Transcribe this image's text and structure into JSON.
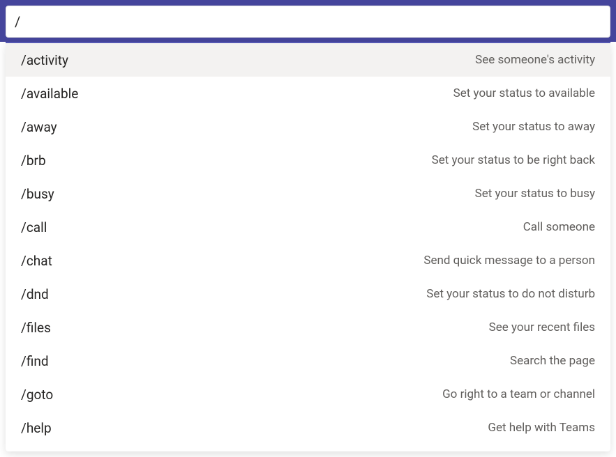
{
  "search": {
    "value": "/"
  },
  "commands": [
    {
      "name": "/activity",
      "desc": "See someone's activity",
      "highlighted": true
    },
    {
      "name": "/available",
      "desc": "Set your status to available",
      "highlighted": false
    },
    {
      "name": "/away",
      "desc": "Set your status to away",
      "highlighted": false
    },
    {
      "name": "/brb",
      "desc": "Set your status to be right back",
      "highlighted": false
    },
    {
      "name": "/busy",
      "desc": "Set your status to busy",
      "highlighted": false
    },
    {
      "name": "/call",
      "desc": "Call someone",
      "highlighted": false
    },
    {
      "name": "/chat",
      "desc": "Send quick message to a person",
      "highlighted": false
    },
    {
      "name": "/dnd",
      "desc": "Set your status to do not disturb",
      "highlighted": false
    },
    {
      "name": "/files",
      "desc": "See your recent files",
      "highlighted": false
    },
    {
      "name": "/find",
      "desc": "Search the page",
      "highlighted": false
    },
    {
      "name": "/goto",
      "desc": "Go right to a team or channel",
      "highlighted": false
    },
    {
      "name": "/help",
      "desc": "Get help with Teams",
      "highlighted": false
    }
  ]
}
